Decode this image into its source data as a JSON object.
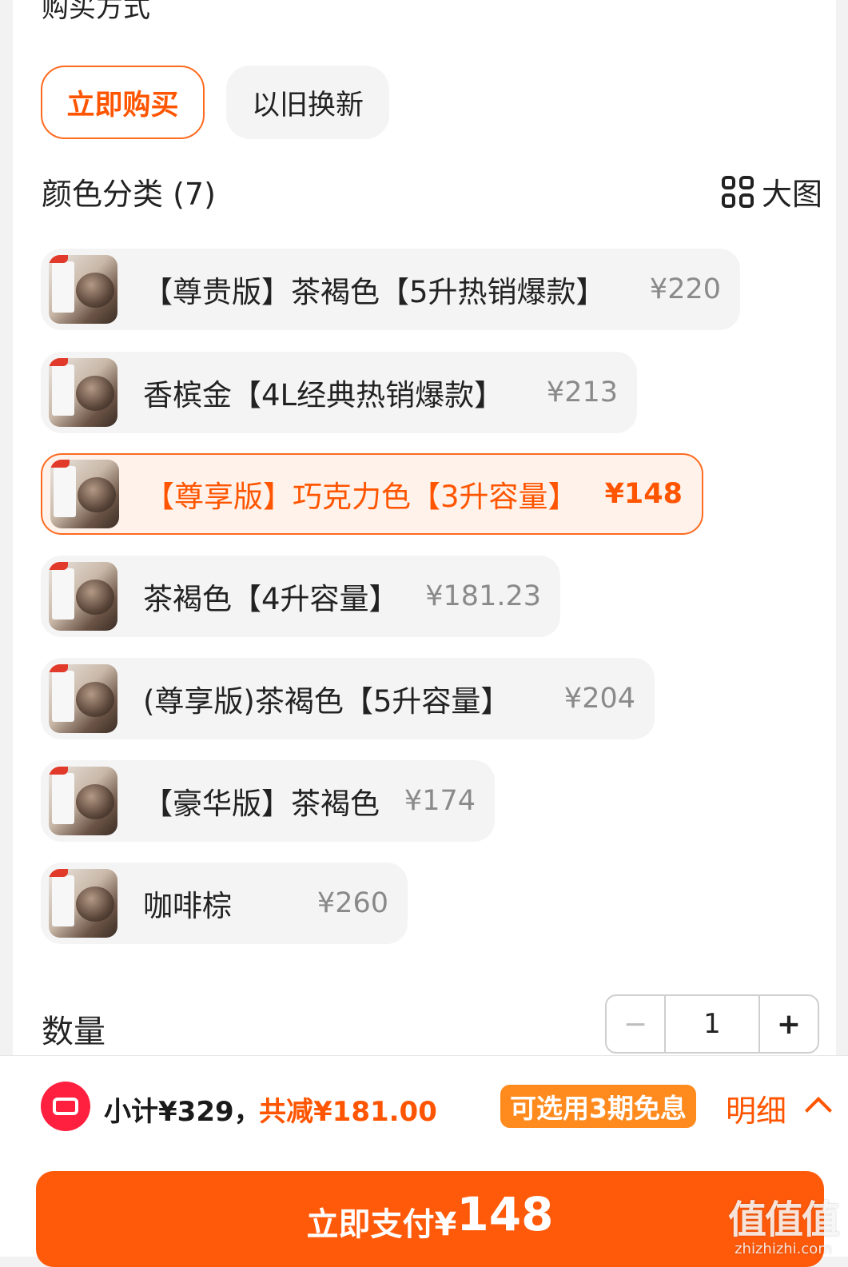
{
  "purchase": {
    "section_title": "购买方式",
    "buy_now": "立即购买",
    "trade_in": "以旧换新"
  },
  "colors": {
    "title": "颜色分类 (7)",
    "big_picture": "大图",
    "options": [
      {
        "label": "【尊贵版】茶褐色【5升热销爆款】",
        "price": "¥220"
      },
      {
        "label": "香槟金【4L经典热销爆款】",
        "price": "¥213"
      },
      {
        "label": "【尊享版】巧克力色【3升容量】",
        "price": "¥148"
      },
      {
        "label": "茶褐色【4升容量】",
        "price": "¥181.23"
      },
      {
        "label": "(尊享版)茶褐色【5升容量】",
        "price": "¥204"
      },
      {
        "label": "【豪华版】茶褐色",
        "price": "¥174"
      },
      {
        "label": "咖啡棕",
        "price": "¥260"
      }
    ],
    "selected_index": 2
  },
  "quantity": {
    "label": "数量",
    "minus": "−",
    "value": "1",
    "plus": "+"
  },
  "summary": {
    "subtotal": "小计¥329，",
    "discount": "共减¥181.00",
    "interest_free": "可选用3期免息",
    "detail": "明细"
  },
  "pay": {
    "label": "立即支付¥",
    "amount": "148"
  },
  "watermark": {
    "main": "值值值",
    "sub": "zhizhizhi.com"
  },
  "theme": {
    "accent": "#ff5500",
    "pay_button": "#ff5a0a",
    "badge": "#ff8a1e",
    "coupon_red": "#ff1f3f"
  }
}
